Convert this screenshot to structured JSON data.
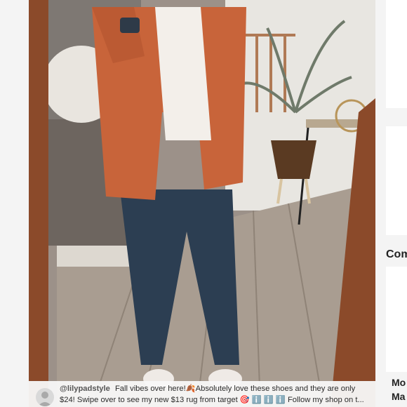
{
  "listing": {
    "photo_alt": "Mirror selfie outfit photo",
    "caption": {
      "username": "@lilypadstyle",
      "text": "Fall vibes over here!🍂Absolutely love these shoes and they are only $24! Swipe over to see my new $13 rug from target 🎯 ℹ️ ℹ️ ℹ️ Follow my shop on t..."
    }
  },
  "sidebar": {
    "heading": "Com",
    "items": [
      {
        "title_line1": "Mo",
        "title_line2": "Ma"
      }
    ]
  },
  "colors": {
    "page_bg": "#f4f4f4",
    "frame_wood": "#8b4a2a",
    "cardigan": "#c8643a",
    "jeans": "#2c3e52"
  }
}
